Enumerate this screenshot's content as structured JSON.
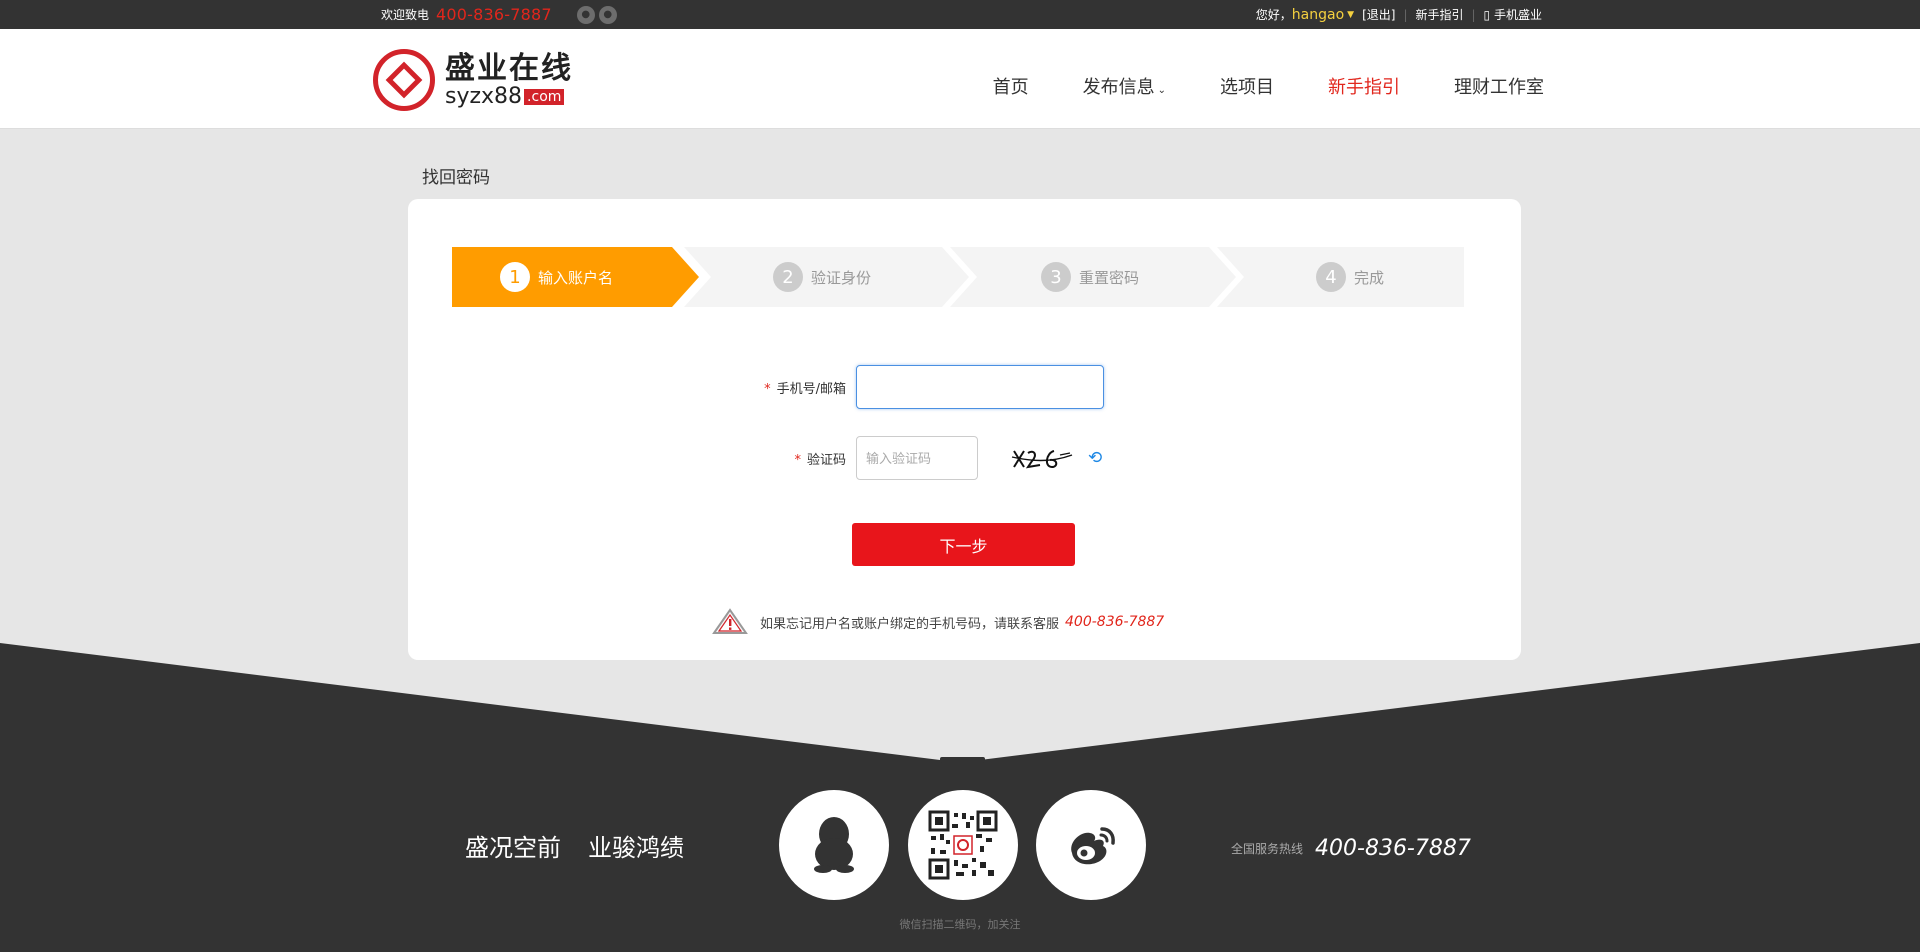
{
  "topbar": {
    "welcome": "欢迎致电",
    "phone": "400-836-7887",
    "greeting": "您好，",
    "username": "hangao",
    "logout": "[退出]",
    "guide": "新手指引",
    "mobile": "手机盛业"
  },
  "logo": {
    "cn": "盛业在线",
    "en": "syzx88",
    "domain": ".com"
  },
  "nav": {
    "home": "首页",
    "publish": "发布信息",
    "projects": "选项目",
    "guide": "新手指引",
    "studio": "理财工作室"
  },
  "page": {
    "title": "找回密码"
  },
  "steps": [
    {
      "num": "1",
      "label": "输入账户名"
    },
    {
      "num": "2",
      "label": "验证身份"
    },
    {
      "num": "3",
      "label": "重置密码"
    },
    {
      "num": "4",
      "label": "完成"
    }
  ],
  "form": {
    "account_label": "手机号/邮箱",
    "account_value": "",
    "code_label": "验证码",
    "code_placeholder": "输入验证码",
    "required_mark": "*",
    "next_label": "下一步"
  },
  "notice": {
    "text": "如果忘记用户名或账户绑定的手机号码，请联系客服",
    "phone": "400-836-7887"
  },
  "footer": {
    "slogan1": "盛况空前",
    "slogan2": "业骏鸿绩",
    "hotline_label": "全国服务热线",
    "hotline": "400-836-7887",
    "follow": "微信扫描二维码，加关注"
  },
  "colors": {
    "brand_red": "#e1261c",
    "step_active": "#ff9c00",
    "step_inactive": "#f4f4f4",
    "footer_dark": "#333333"
  }
}
